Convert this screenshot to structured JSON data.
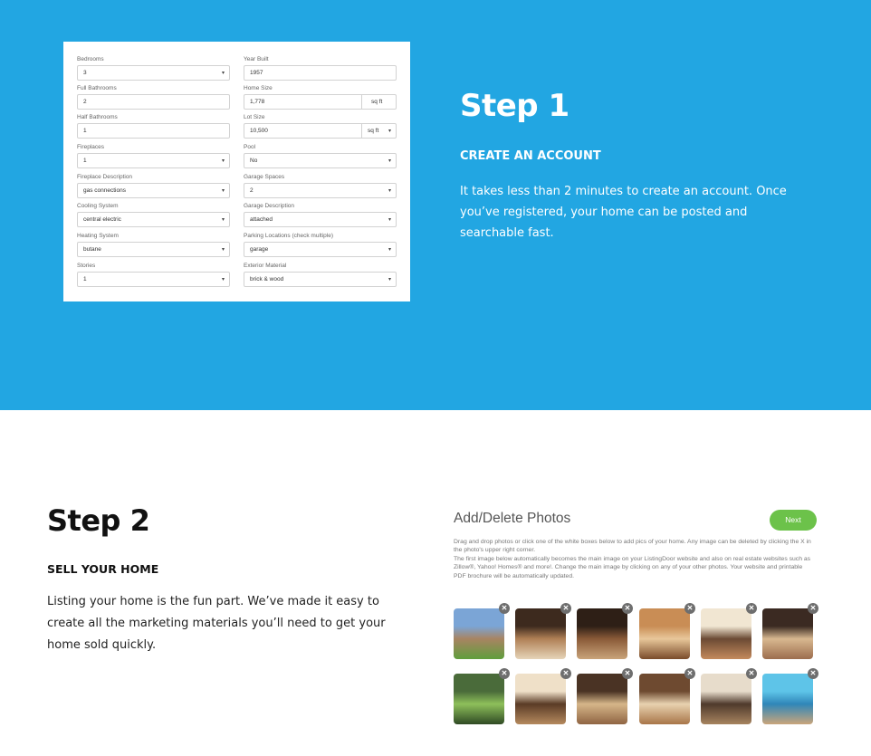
{
  "step1": {
    "title": "Step 1",
    "subtitle": "CREATE AN ACCOUNT",
    "body": "It takes less than 2 minutes to create an account. Once you’ve registered, your home can be posted and searchable fast."
  },
  "form": {
    "bedrooms": {
      "label": "Bedrooms",
      "value": "3"
    },
    "year_built": {
      "label": "Year Built",
      "value": "1957"
    },
    "full_bathrooms": {
      "label": "Full Bathrooms",
      "value": "2"
    },
    "home_size": {
      "label": "Home Size",
      "value": "1,778",
      "unit": "sq ft"
    },
    "half_bathrooms": {
      "label": "Half Bathrooms",
      "value": "1"
    },
    "lot_size": {
      "label": "Lot Size",
      "value": "10,500",
      "unit": "sq ft"
    },
    "fireplaces": {
      "label": "Fireplaces",
      "value": "1"
    },
    "pool": {
      "label": "Pool",
      "value": "No"
    },
    "fireplace_description": {
      "label": "Fireplace Description",
      "value": "gas connections"
    },
    "garage_spaces": {
      "label": "Garage Spaces",
      "value": "2"
    },
    "cooling_system": {
      "label": "Cooling System",
      "value": "central electric"
    },
    "garage_description": {
      "label": "Garage Description",
      "value": "attached"
    },
    "heating_system": {
      "label": "Heating System",
      "value": "butane"
    },
    "parking_locations": {
      "label": "Parking Locations (check multiple)",
      "value": "garage"
    },
    "stories": {
      "label": "Stories",
      "value": "1"
    },
    "exterior_material": {
      "label": "Exterior Material",
      "value": "brick & wood"
    }
  },
  "step2": {
    "title": "Step 2",
    "subtitle": "SELL YOUR HOME",
    "body": "Listing your home is the fun part. We’ve made it easy to create all the marketing materials you’ll need to get your home sold quickly."
  },
  "photos": {
    "title": "Add/Delete Photos",
    "next_label": "Next",
    "desc1": "Drag and drop photos or click one of the white boxes below to add pics of your home. Any image can be deleted by clicking the X in the photo's upper right corner.",
    "desc2": "The first image below automatically becomes the main image on your ListingDoor website and also on real estate websites such as Zillow®, Yahoo! Homes® and more!. Change the main image by clicking on any of your other photos. Your website and printable PDF brochure will be automatically updated.",
    "delete_glyph": "✕",
    "caret_glyph": "▾",
    "accent_color": "#22a6e2",
    "next_color": "#6cc24a",
    "thumbnails": [
      "exterior",
      "kitchen",
      "dining-room",
      "kitchen-2",
      "living-room",
      "bedroom",
      "backyard",
      "dining-room-2",
      "great-room",
      "staircase",
      "master-bedroom",
      "pool"
    ]
  }
}
